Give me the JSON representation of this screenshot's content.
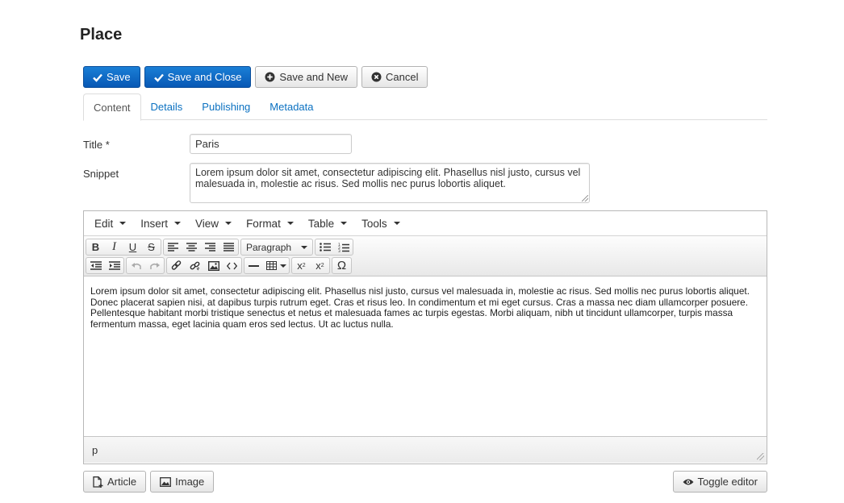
{
  "page": {
    "title": "Place"
  },
  "toolbar": {
    "save": "Save",
    "save_close": "Save and Close",
    "save_new": "Save and New",
    "cancel": "Cancel"
  },
  "tabs": [
    {
      "label": "Content",
      "active": true
    },
    {
      "label": "Details"
    },
    {
      "label": "Publishing"
    },
    {
      "label": "Metadata"
    }
  ],
  "form": {
    "title_label": "Title *",
    "title_value": "Paris",
    "snippet_label": "Snippet",
    "snippet_value": "Lorem ipsum dolor sit amet, consectetur adipiscing elit. Phasellus nisl justo, cursus vel malesuada in, molestie ac risus. Sed mollis nec purus lobortis aliquet."
  },
  "editor": {
    "menu": [
      "Edit",
      "Insert",
      "View",
      "Format",
      "Table",
      "Tools"
    ],
    "format_select": "Paragraph",
    "body": "Lorem ipsum dolor sit amet, consectetur adipiscing elit. Phasellus nisl justo, cursus vel malesuada in, molestie ac risus. Sed mollis nec purus lobortis aliquet. Donec placerat sapien nisi, at dapibus turpis rutrum eget. Cras et risus leo. In condimentum et mi eget cursus. Cras a massa nec diam ullamcorper posuere. Pellentesque habitant morbi tristique senectus et netus et malesuada fames ac turpis egestas. Morbi aliquam, nibh ut tincidunt ullamcorper, turpis massa fermentum massa, eget lacinia quam eros sed lectus. Ut ac luctus nulla.",
    "path": "p",
    "icons": {
      "bold": "B",
      "italic": "I",
      "underline": "U",
      "strike": "S",
      "omega": "Ω",
      "subscript": "x",
      "superscript": "x"
    }
  },
  "bottom": {
    "article": "Article",
    "image": "Image",
    "toggle": "Toggle editor"
  },
  "colors": {
    "primary": "#0858b5",
    "link": "#0b71c1"
  }
}
